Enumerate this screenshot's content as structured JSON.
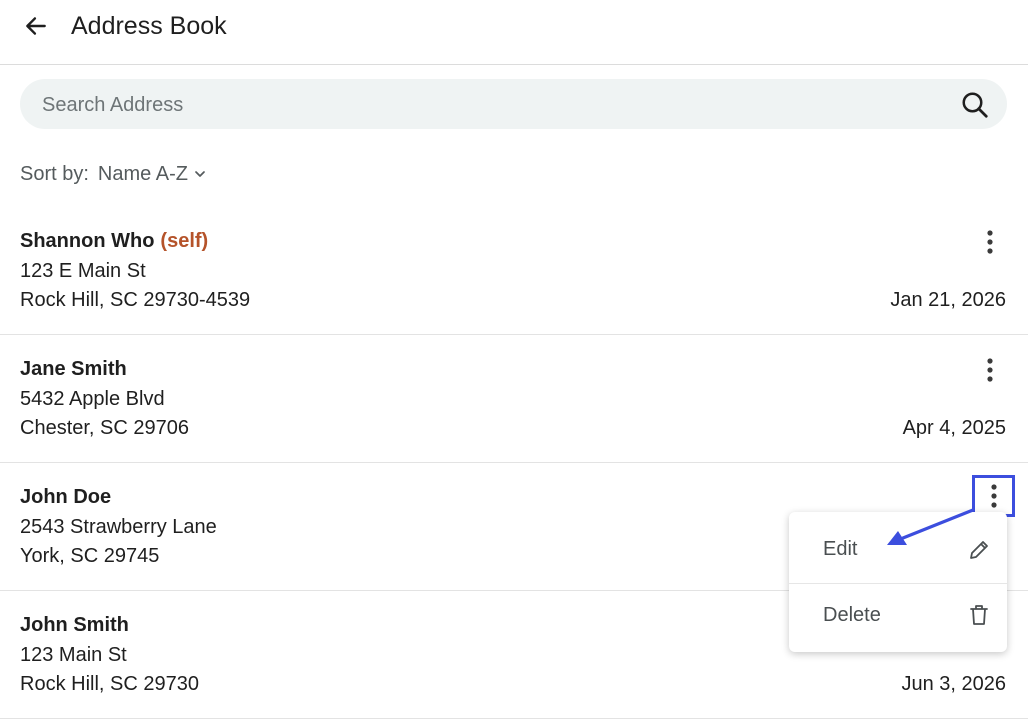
{
  "header": {
    "title": "Address Book",
    "back_icon": "arrow-left-icon"
  },
  "search": {
    "placeholder": "Search Address",
    "value": "",
    "icon": "search-icon"
  },
  "sort": {
    "label": "Sort by:",
    "value": "Name A-Z",
    "icon": "chevron-down-icon"
  },
  "addresses": [
    {
      "name": "Shannon Who",
      "tag": "(self)",
      "line1": "123 E Main St",
      "line2": "Rock Hill, SC 29730-4539",
      "date": "Jan 21, 2026"
    },
    {
      "name": "Jane Smith",
      "tag": "",
      "line1": "5432 Apple Blvd",
      "line2": "Chester, SC 29706",
      "date": "Apr 4, 2025"
    },
    {
      "name": "John Doe",
      "tag": "",
      "line1": "2543 Strawberry Lane",
      "line2": "York, SC 29745",
      "date": ""
    },
    {
      "name": "John Smith",
      "tag": "",
      "line1": "123 Main St",
      "line2": "Rock Hill, SC 29730",
      "date": "Jun 3, 2026"
    }
  ],
  "menu": {
    "edit_label": "Edit",
    "edit_icon": "pencil-icon",
    "delete_label": "Delete",
    "delete_icon": "trash-icon"
  },
  "colors": {
    "self_tag": "#b5532a",
    "highlight": "#3c4ede",
    "search_bg": "#eff3f3"
  }
}
